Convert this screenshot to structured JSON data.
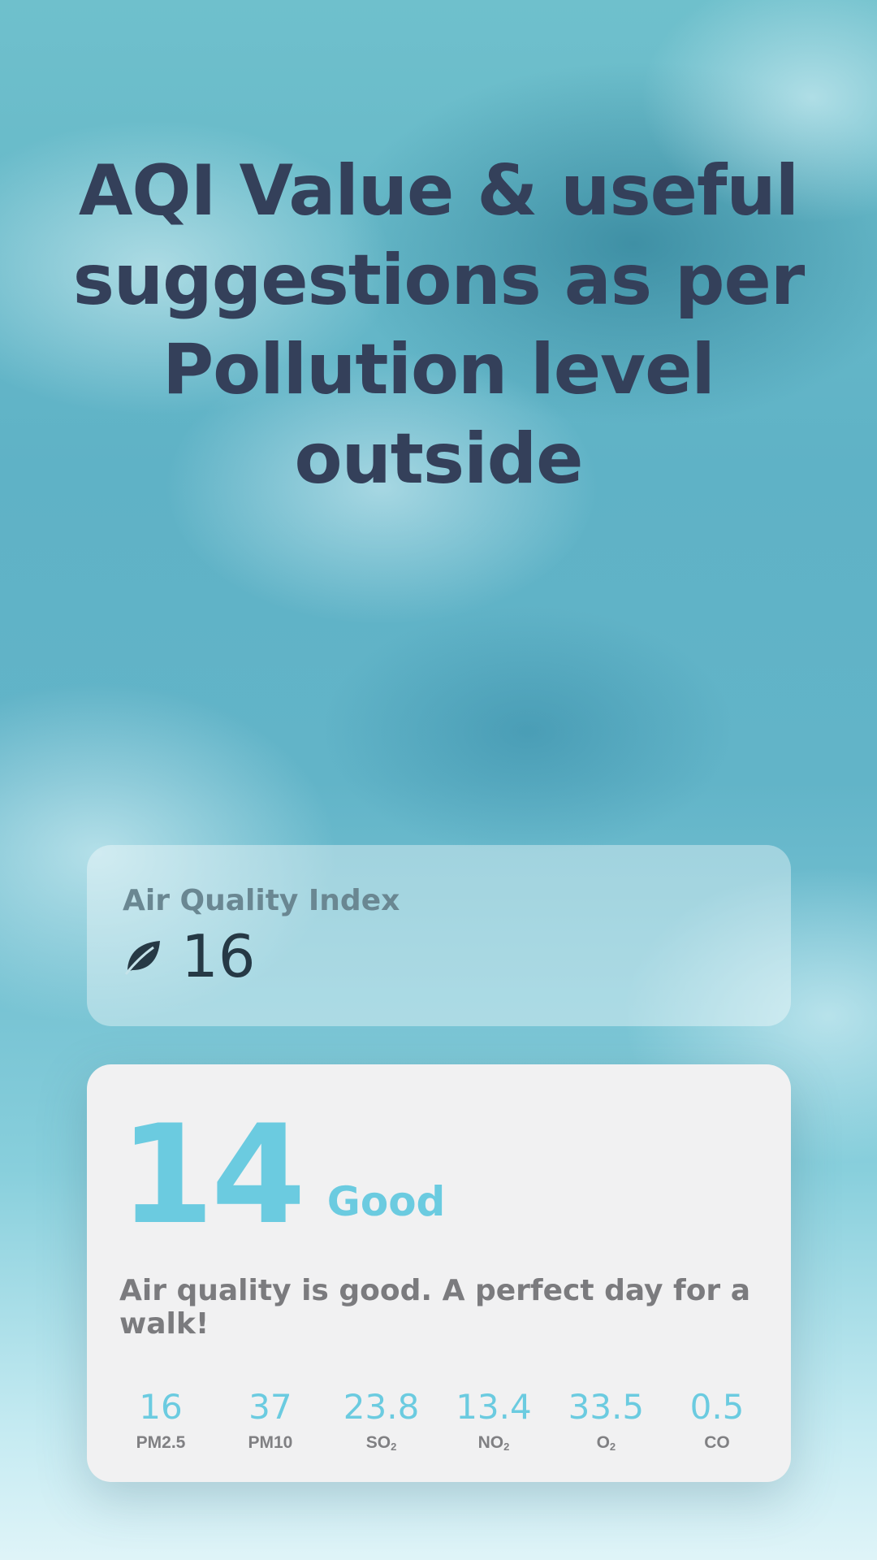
{
  "headline": "AQI Value & useful suggestions as per Pollution level outside",
  "aqi_card": {
    "label": "Air Quality Index",
    "icon": "leaf-icon",
    "value": "16"
  },
  "detail_card": {
    "score": "14",
    "level": "Good",
    "advice": "Air quality is good. A perfect day for a walk!",
    "pollutants": [
      {
        "value": "16",
        "name": "PM2.5",
        "sub": ""
      },
      {
        "value": "37",
        "name": "PM10",
        "sub": ""
      },
      {
        "value": "23.8",
        "name": "SO",
        "sub": "2"
      },
      {
        "value": "13.4",
        "name": "NO",
        "sub": "2"
      },
      {
        "value": "33.5",
        "name": "O",
        "sub": "2"
      },
      {
        "value": "0.5",
        "name": "CO",
        "sub": ""
      }
    ]
  },
  "colors": {
    "accent": "#6bcbe0",
    "headline": "#34405a",
    "card_bg": "#f1f1f2"
  }
}
